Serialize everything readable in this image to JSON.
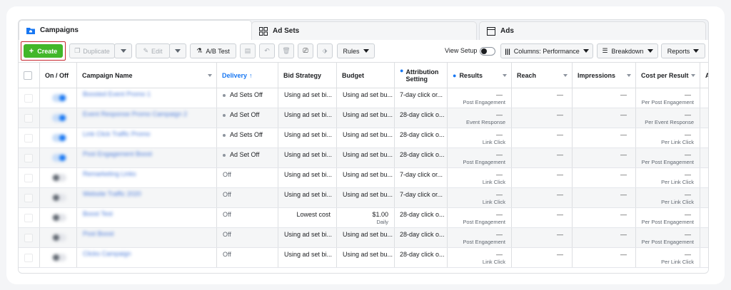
{
  "tabs": [
    {
      "label": "Campaigns",
      "icon": "folder-icon",
      "active": true
    },
    {
      "label": "Ad Sets",
      "icon": "grid-icon",
      "active": false
    },
    {
      "label": "Ads",
      "icon": "ad-icon",
      "active": false
    }
  ],
  "toolbar": {
    "create_label": "Create",
    "duplicate_label": "Duplicate",
    "edit_label": "Edit",
    "ab_test_label": "A/B Test",
    "rules_label": "Rules",
    "view_setup_label": "View Setup",
    "columns_label": "Columns: Performance",
    "breakdown_label": "Breakdown",
    "reports_label": "Reports"
  },
  "columns": {
    "on_off": "On / Off",
    "campaign_name": "Campaign Name",
    "delivery": "Delivery",
    "bid_strategy": "Bid Strategy",
    "budget": "Budget",
    "attribution": "Attribution Setting",
    "results": "Results",
    "reach": "Reach",
    "impressions": "Impressions",
    "cost_per_result": "Cost per Result",
    "next": "A"
  },
  "rows": [
    {
      "name": "Boosted Event Promo 1",
      "delivery": "Ad Sets Off",
      "active": true,
      "bid": "Using ad set bi...",
      "budget": "Using ad set bu...",
      "budget_sub": "",
      "attribution": "7-day click or...",
      "results": "—",
      "results_sub": "Post Engagement",
      "reach": "—",
      "impressions": "—",
      "cost": "—",
      "cost_sub": "Per Post Engagement"
    },
    {
      "name": "Event Response Promo Campaign 2",
      "delivery": "Ad Set Off",
      "active": true,
      "bid": "Using ad set bi...",
      "budget": "Using ad set bu...",
      "budget_sub": "",
      "attribution": "28-day click o...",
      "results": "—",
      "results_sub": "Event Response",
      "reach": "—",
      "impressions": "—",
      "cost": "—",
      "cost_sub": "Per Event Response"
    },
    {
      "name": "Link Click Traffic Promo",
      "delivery": "Ad Sets Off",
      "active": true,
      "bid": "Using ad set bi...",
      "budget": "Using ad set bu...",
      "budget_sub": "",
      "attribution": "28-day click o...",
      "results": "—",
      "results_sub": "Link Click",
      "reach": "—",
      "impressions": "—",
      "cost": "—",
      "cost_sub": "Per Link Click"
    },
    {
      "name": "Post Engagement Boost",
      "delivery": "Ad Set Off",
      "active": true,
      "bid": "Using ad set bi...",
      "budget": "Using ad set bu...",
      "budget_sub": "",
      "attribution": "28-day click o...",
      "results": "—",
      "results_sub": "Post Engagement",
      "reach": "—",
      "impressions": "—",
      "cost": "—",
      "cost_sub": "Per Post Engagement"
    },
    {
      "name": "Remarketing Links",
      "delivery": "Off",
      "active": false,
      "bid": "Using ad set bi...",
      "budget": "Using ad set bu...",
      "budget_sub": "",
      "attribution": "7-day click or...",
      "results": "—",
      "results_sub": "Link Click",
      "reach": "—",
      "impressions": "—",
      "cost": "—",
      "cost_sub": "Per Link Click"
    },
    {
      "name": "Website Traffic 2020",
      "delivery": "Off",
      "active": false,
      "bid": "Using ad set bi...",
      "budget": "Using ad set bu...",
      "budget_sub": "",
      "attribution": "7-day click or...",
      "results": "—",
      "results_sub": "Link Click",
      "reach": "—",
      "impressions": "—",
      "cost": "—",
      "cost_sub": "Per Link Click"
    },
    {
      "name": "Boost Test",
      "delivery": "Off",
      "active": false,
      "bid": "Lowest cost",
      "budget": "$1.00",
      "budget_sub": "Daily",
      "attribution": "28-day click o...",
      "results": "—",
      "results_sub": "Post Engagement",
      "reach": "—",
      "impressions": "—",
      "cost": "—",
      "cost_sub": "Per Post Engagement"
    },
    {
      "name": "Post Boost",
      "delivery": "Off",
      "active": false,
      "bid": "Using ad set bi...",
      "budget": "Using ad set bu...",
      "budget_sub": "",
      "attribution": "28-day click o...",
      "results": "—",
      "results_sub": "Post Engagement",
      "reach": "—",
      "impressions": "—",
      "cost": "—",
      "cost_sub": "Per Post Engagement"
    },
    {
      "name": "Clicks Campaign",
      "delivery": "Off",
      "active": false,
      "bid": "Using ad set bi...",
      "budget": "Using ad set bu...",
      "budget_sub": "",
      "attribution": "28-day click o...",
      "results": "—",
      "results_sub": "Link Click",
      "reach": "—",
      "impressions": "—",
      "cost": "—",
      "cost_sub": "Per Link Click"
    }
  ],
  "colors": {
    "accent_blue": "#1877f2",
    "create_green": "#42b72a",
    "highlight_red": "#c6262e"
  }
}
